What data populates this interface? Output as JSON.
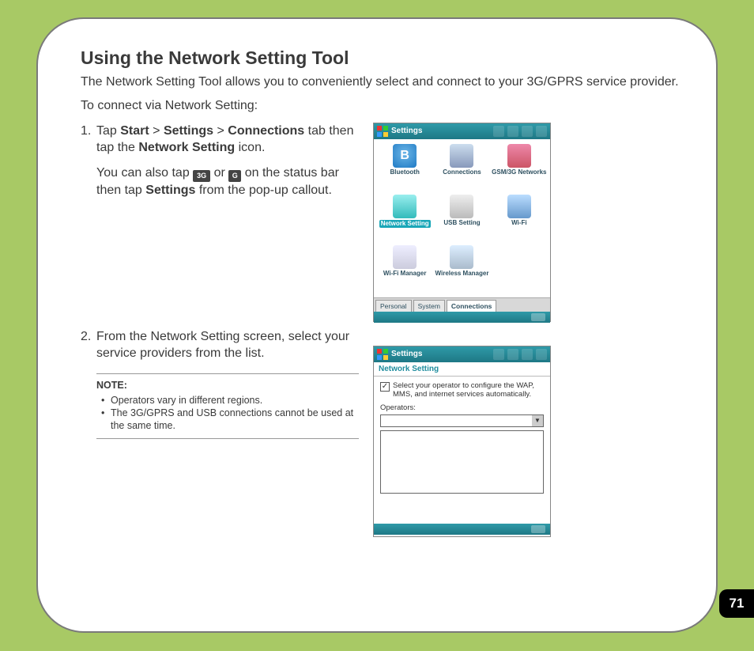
{
  "title": "Using the Network Setting Tool",
  "intro": "The Network Setting Tool allows you to conveniently select and connect to your 3G/GPRS service provider.",
  "lead": "To connect via Network Setting:",
  "step1": {
    "num": "1.",
    "pre": "Tap ",
    "start": "Start",
    "gt1": " > ",
    "settings": "Settings",
    "gt2": " > ",
    "connections": "Connections",
    "mid1": " tab then tap the ",
    "netset": "Network Setting",
    "mid2": " icon.",
    "line2a": "You can also tap ",
    "icon3g": "3G",
    "or": " or ",
    "iconG": "G",
    "line2b": " on the status bar then tap ",
    "settings2": "Settings",
    "line2c": " from the pop-up callout."
  },
  "step2": {
    "num": "2.",
    "text": "From the Network Setting screen, select your service providers from the list."
  },
  "note": {
    "label": "NOTE:",
    "b1": "Operators vary in different regions.",
    "b2": "The 3G/GPRS and USB connections cannot be used at the same time."
  },
  "shot1": {
    "title": "Settings",
    "icons": {
      "bt": "Bluetooth",
      "conn": "Connections",
      "gsm": "GSM/3G Networks",
      "net": "Network Setting",
      "usb": "USB Setting",
      "wifi": "Wi-Fi",
      "wifimgr": "Wi-Fi Manager",
      "wmgr": "Wireless Manager"
    },
    "tabs": {
      "personal": "Personal",
      "system": "System",
      "connections": "Connections"
    }
  },
  "shot2": {
    "title": "Settings",
    "sub": "Network Setting",
    "desc": "Select your operator to configure the WAP, MMS, and internet services automatically.",
    "operators": "Operators:"
  },
  "pageNumber": "71"
}
